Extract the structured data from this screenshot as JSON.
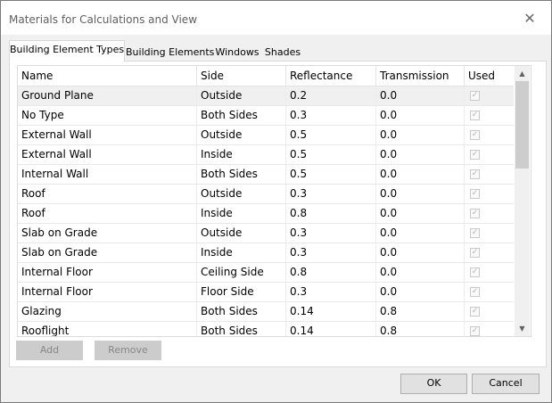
{
  "window": {
    "title": "Materials for Calculations and View",
    "close_glyph": "✕"
  },
  "tabs": [
    {
      "label": "Building Element Types",
      "active": true
    },
    {
      "label": "Building Elements",
      "active": false
    },
    {
      "label": "Windows",
      "active": false
    },
    {
      "label": "Shades",
      "active": false
    }
  ],
  "table": {
    "columns": [
      "Name",
      "Side",
      "Reflectance",
      "Transmission",
      "Used"
    ],
    "rows": [
      {
        "name": "Ground Plane",
        "side": "Outside",
        "reflectance": "0.2",
        "transmission": "0.0",
        "used": true,
        "selected": true
      },
      {
        "name": "No Type",
        "side": "Both Sides",
        "reflectance": "0.3",
        "transmission": "0.0",
        "used": true
      },
      {
        "name": "External Wall",
        "side": "Outside",
        "reflectance": "0.5",
        "transmission": "0.0",
        "used": true
      },
      {
        "name": "External Wall",
        "side": "Inside",
        "reflectance": "0.5",
        "transmission": "0.0",
        "used": true
      },
      {
        "name": "Internal Wall",
        "side": "Both Sides",
        "reflectance": "0.5",
        "transmission": "0.0",
        "used": true
      },
      {
        "name": "Roof",
        "side": "Outside",
        "reflectance": "0.3",
        "transmission": "0.0",
        "used": true
      },
      {
        "name": "Roof",
        "side": "Inside",
        "reflectance": "0.8",
        "transmission": "0.0",
        "used": true
      },
      {
        "name": "Slab on Grade",
        "side": "Outside",
        "reflectance": "0.3",
        "transmission": "0.0",
        "used": true
      },
      {
        "name": "Slab on Grade",
        "side": "Inside",
        "reflectance": "0.3",
        "transmission": "0.0",
        "used": true
      },
      {
        "name": "Internal Floor",
        "side": "Ceiling Side",
        "reflectance": "0.8",
        "transmission": "0.0",
        "used": true
      },
      {
        "name": "Internal Floor",
        "side": "Floor Side",
        "reflectance": "0.3",
        "transmission": "0.0",
        "used": true
      },
      {
        "name": "Glazing",
        "side": "Both Sides",
        "reflectance": "0.14",
        "transmission": "0.8",
        "used": true
      },
      {
        "name": "Rooflight",
        "side": "Both Sides",
        "reflectance": "0.14",
        "transmission": "0.8",
        "used": true
      }
    ]
  },
  "scrollbar": {
    "up_glyph": "▲",
    "down_glyph": "▼"
  },
  "buttons": {
    "add": "Add",
    "remove": "Remove",
    "ok": "OK",
    "cancel": "Cancel"
  },
  "colors": {
    "selected_row": "#f0f0f0",
    "disabled_button": "#cccccc",
    "dialog_background": "#f0f0f0"
  }
}
